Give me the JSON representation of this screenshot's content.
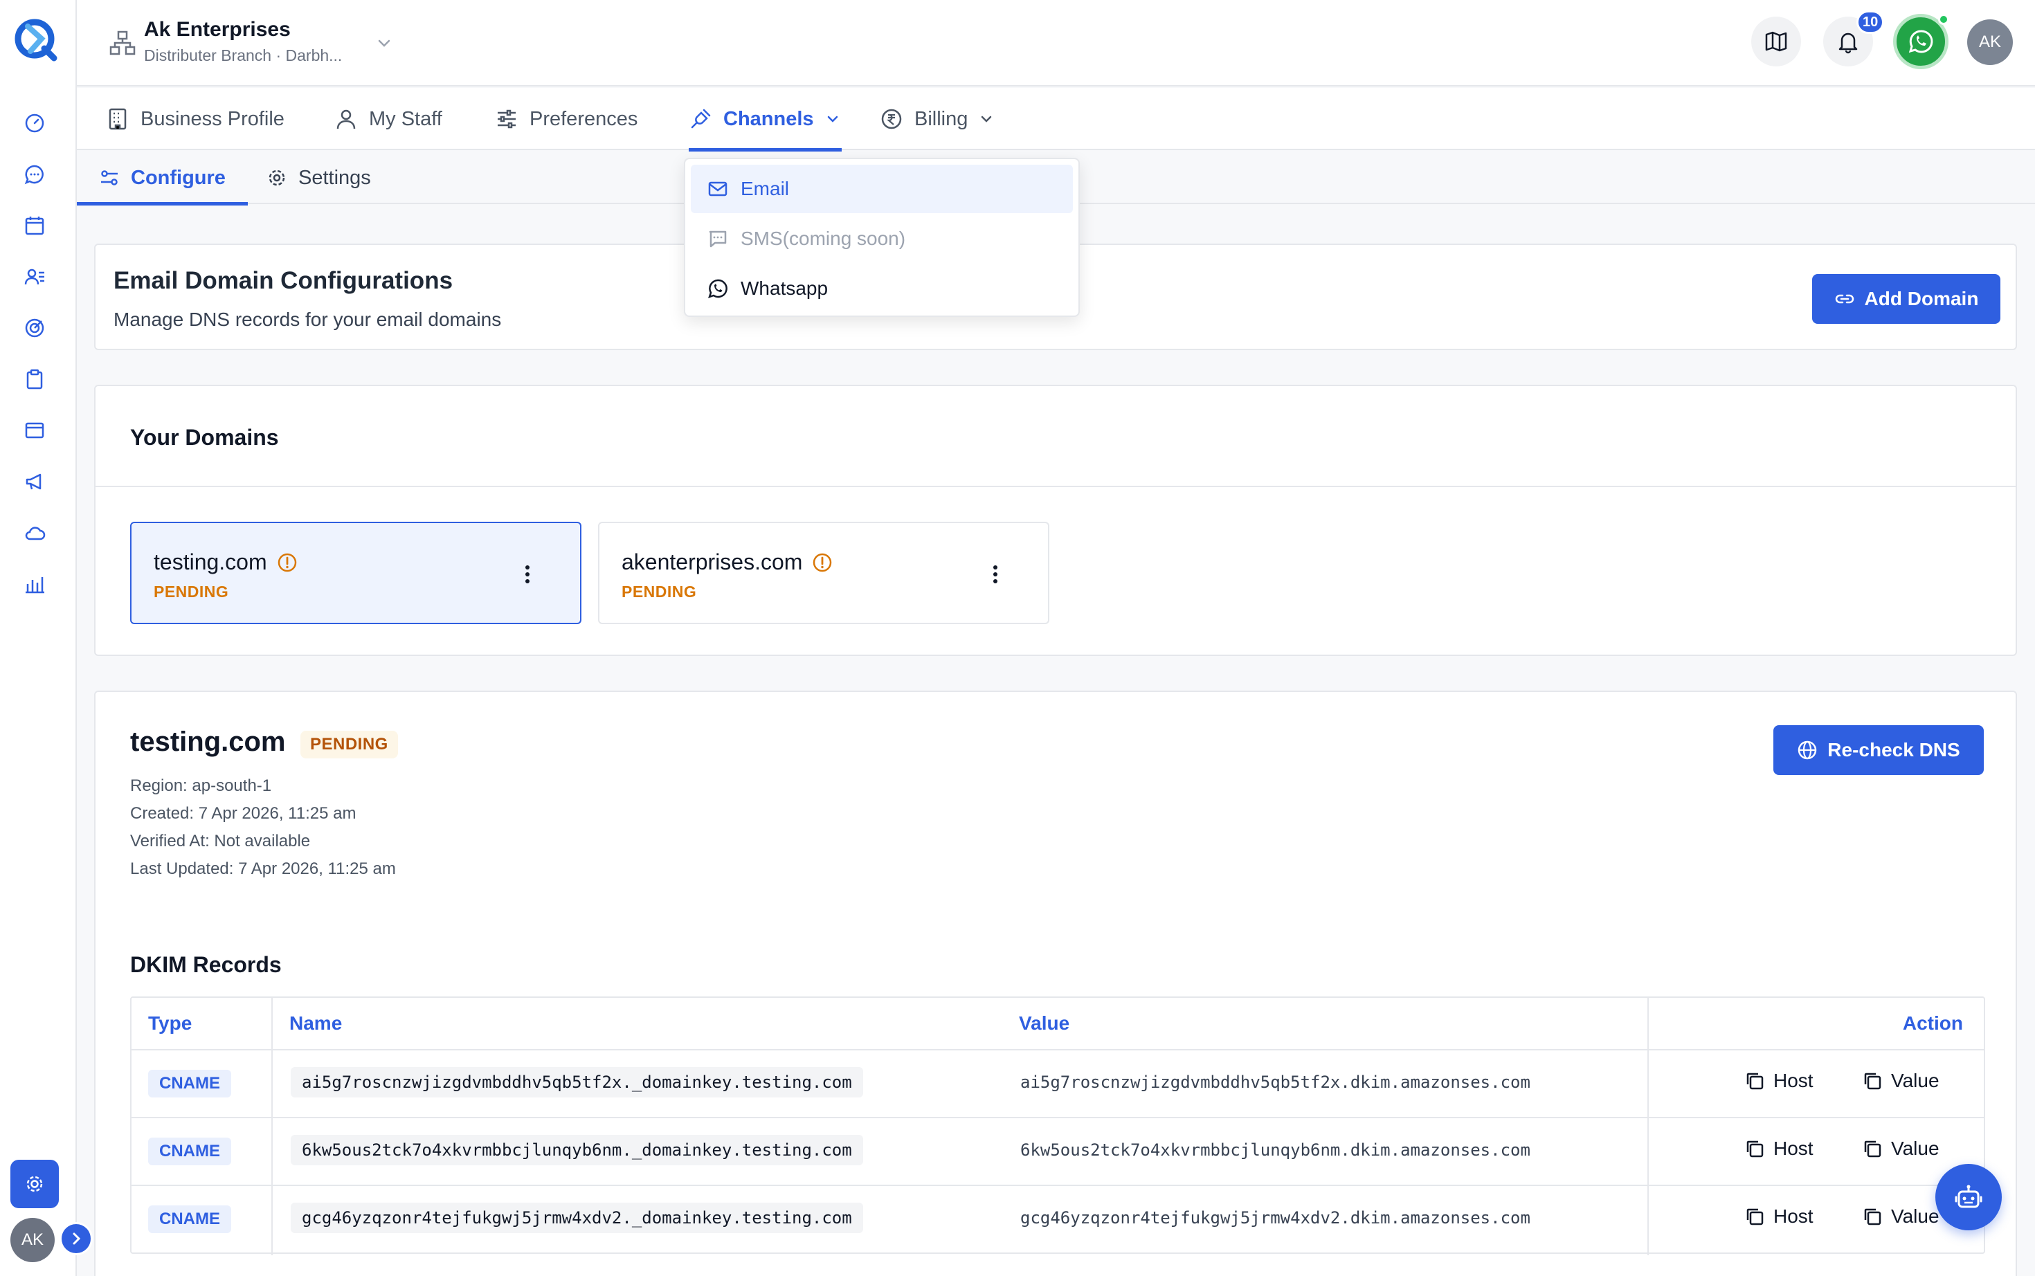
{
  "org": {
    "name": "Ak Enterprises",
    "subtitle": "Distributer Branch · Darbh..."
  },
  "topbar": {
    "notification_count": "10",
    "avatar_initials": "AK"
  },
  "main_tabs": [
    {
      "label": "Business Profile",
      "icon": "building-icon"
    },
    {
      "label": "My Staff",
      "icon": "user-icon"
    },
    {
      "label": "Preferences",
      "icon": "sliders-icon"
    },
    {
      "label": "Channels",
      "icon": "plug-icon",
      "active": true
    },
    {
      "label": "Billing",
      "icon": "rupee-icon"
    }
  ],
  "sub_tabs": [
    {
      "label": "Configure",
      "active": true
    },
    {
      "label": "Settings"
    }
  ],
  "channels_menu": [
    {
      "label": "Email",
      "icon": "mail-icon",
      "active": true
    },
    {
      "label": "SMS(coming soon)",
      "icon": "sms-icon",
      "disabled": true
    },
    {
      "label": "Whatsapp",
      "icon": "whatsapp-icon"
    }
  ],
  "header": {
    "title": "Email Domain Configurations",
    "subtitle": "Manage DNS records for your email domains",
    "add_domain_label": "Add Domain"
  },
  "domains": {
    "title": "Your Domains",
    "items": [
      {
        "name": "testing.com",
        "status": "PENDING",
        "selected": true
      },
      {
        "name": "akenterprises.com",
        "status": "PENDING"
      }
    ]
  },
  "detail": {
    "domain": "testing.com",
    "status": "PENDING",
    "recheck_label": "Re-check DNS",
    "region": "Region: ap-south-1",
    "created": "Created: 7 Apr 2026, 11:25 am",
    "verified": "Verified At: Not available",
    "updated": "Last Updated: 7 Apr 2026, 11:25 am",
    "dkim_title": "DKIM Records",
    "columns": {
      "type": "Type",
      "name": "Name",
      "value": "Value",
      "action": "Action"
    },
    "rows": [
      {
        "type": "CNAME",
        "name": "ai5g7roscnzwjizgdvmbddhv5qb5tf2x._domainkey.testing.com",
        "value": "ai5g7roscnzwjizgdvmbddhv5qb5tf2x.dkim.amazonses.com",
        "host_label": "Host",
        "value_label": "Value"
      },
      {
        "type": "CNAME",
        "name": "6kw5ous2tck7o4xkvrmbbcjlunqyb6nm._domainkey.testing.com",
        "value": "6kw5ous2tck7o4xkvrmbbcjlunqyb6nm.dkim.amazonses.com",
        "host_label": "Host",
        "value_label": "Value"
      },
      {
        "type": "CNAME",
        "name": "gcg46yzqzonr4tejfukgwj5jrmw4xdv2._domainkey.testing.com",
        "value": "gcg46yzqzonr4tejfukgwj5jrmw4xdv2.dkim.amazonses.com",
        "host_label": "Host",
        "value_label": "Value"
      }
    ]
  },
  "rail": {
    "avatar_initials": "AK"
  },
  "colors": {
    "primary": "#2f5fe0",
    "pending": "#d97706",
    "whatsapp": "#22a447"
  }
}
